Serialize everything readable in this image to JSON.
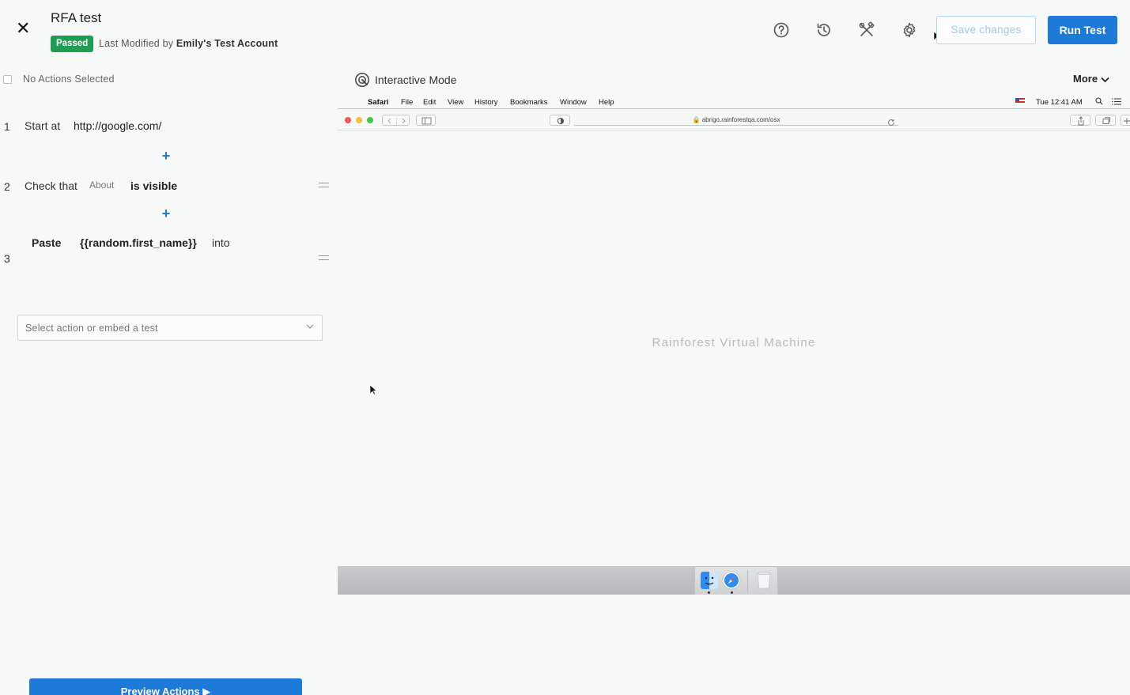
{
  "header": {
    "title": "RFA test",
    "status": "Passed",
    "modified_prefix": "Last Modified by",
    "modified_by": "Emily's Test Account",
    "save_label": "Save changes",
    "run_label": "Run Test",
    "icons": [
      "close-icon",
      "help-icon",
      "history-icon",
      "tools-icon",
      "gear-icon"
    ]
  },
  "actions_panel": {
    "selection_label": "No Actions Selected",
    "steps": [
      {
        "number": "1",
        "verb": "Start at",
        "value": "http://google.com/"
      },
      {
        "number": "2",
        "verb": "Check that",
        "element": "About",
        "condition": "is visible"
      },
      {
        "number": "3",
        "verb": "Paste",
        "value": "{{random.first_name}}",
        "connector": "into"
      }
    ],
    "add_symbol": "+",
    "select_placeholder": "Select action or embed a test",
    "preview_label": "Preview Actions ▶"
  },
  "vm_panel": {
    "mode_label": "Interactive Mode",
    "more_label": "More",
    "menubar": {
      "app": "Safari",
      "menus": [
        "File",
        "Edit",
        "View",
        "History",
        "Bookmarks",
        "Window",
        "Help"
      ],
      "clock": "Tue 12:41 AM"
    },
    "url": "abrigo.rainforestqa.com/osx",
    "center_label": "Rainforest Virtual Machine"
  },
  "colors": {
    "accent": "#1d7ad9",
    "passed": "#1f9d55",
    "background": "#f6f9f8"
  }
}
